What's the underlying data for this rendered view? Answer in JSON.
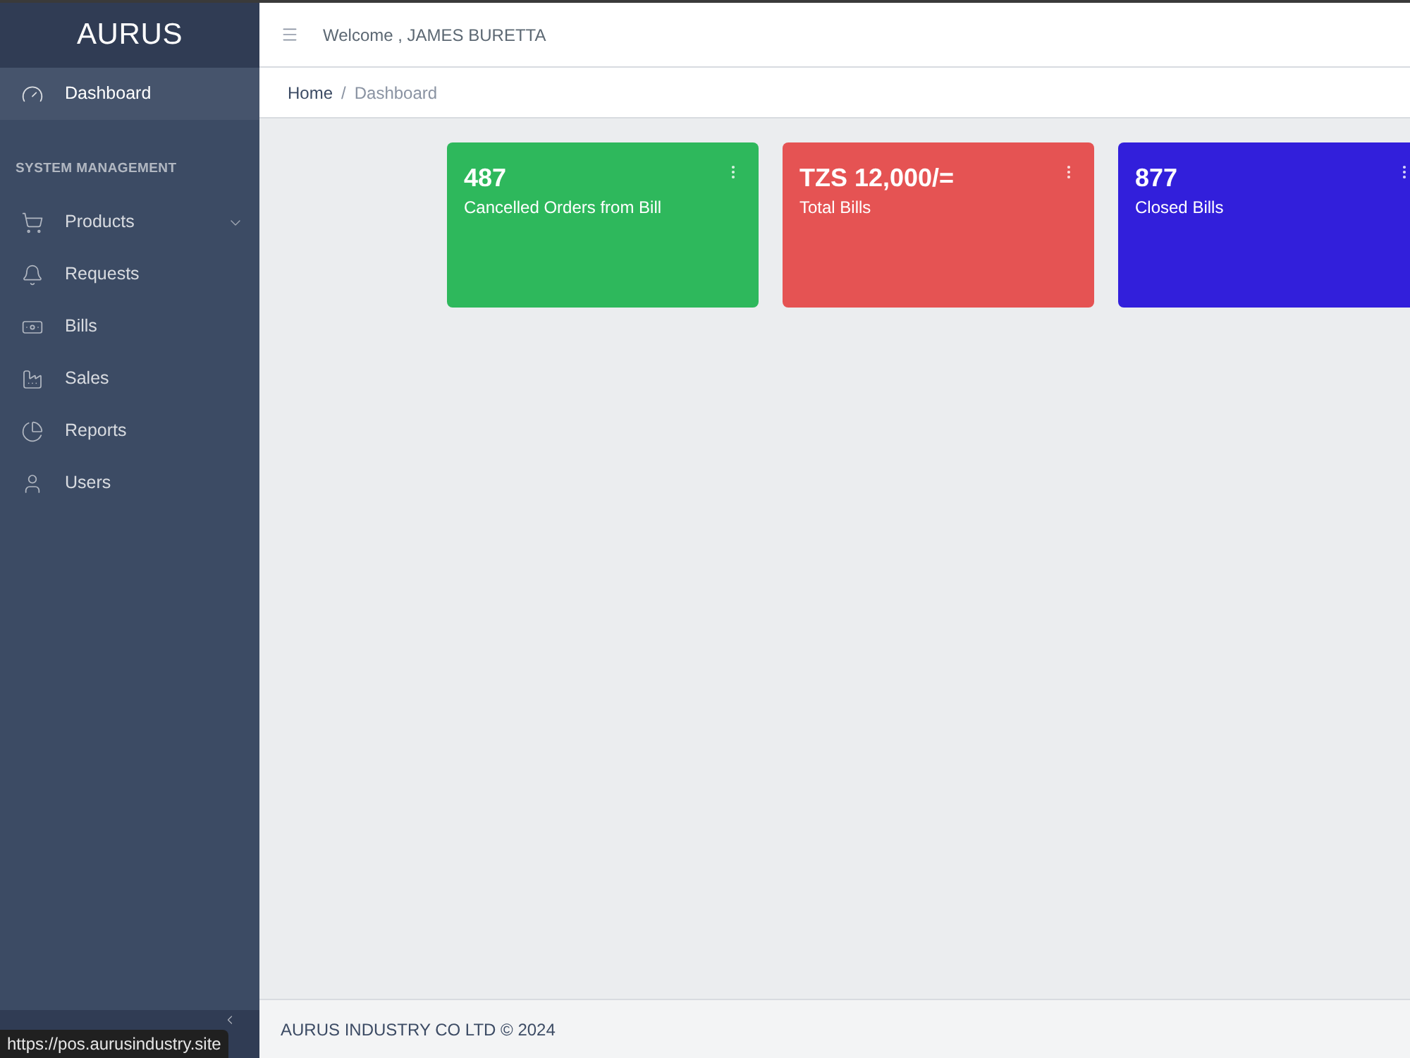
{
  "sidebar": {
    "brand": "AURUS",
    "nav": [
      {
        "kind": "link",
        "label": "Dashboard",
        "selected": true,
        "expandable": false
      },
      {
        "kind": "title",
        "label": "SYSTEM MANAGEMENT"
      },
      {
        "kind": "link",
        "label": "Products",
        "selected": false,
        "expandable": true
      },
      {
        "kind": "link",
        "label": "Requests",
        "selected": false,
        "expandable": false
      },
      {
        "kind": "link",
        "label": "Bills",
        "selected": false,
        "expandable": false
      },
      {
        "kind": "link",
        "label": "Sales",
        "selected": false,
        "expandable": false
      },
      {
        "kind": "link",
        "label": "Reports",
        "selected": false,
        "expandable": false
      },
      {
        "kind": "link",
        "label": "Users",
        "selected": false,
        "expandable": false
      }
    ]
  },
  "header": {
    "welcome": "Welcome , JAMES BURETTA"
  },
  "breadcrumb": {
    "separator": "/",
    "items": [
      {
        "label": "Home",
        "selected": false
      },
      {
        "label": "Dashboard",
        "selected": true
      }
    ]
  },
  "cards": [
    {
      "value": "487",
      "label": "Cancelled Orders from Bill",
      "color": "#2eb85c"
    },
    {
      "value": "TZS 12,000/=",
      "label": "Total Bills",
      "color": "#e55353"
    },
    {
      "value": "877",
      "label": "Closed Bills",
      "color": "#321fdb"
    }
  ],
  "footer": {
    "text": "AURUS INDUSTRY CO LTD © 2024"
  },
  "status_tooltip": {
    "url": "https://pos.aurusindustry.site"
  }
}
